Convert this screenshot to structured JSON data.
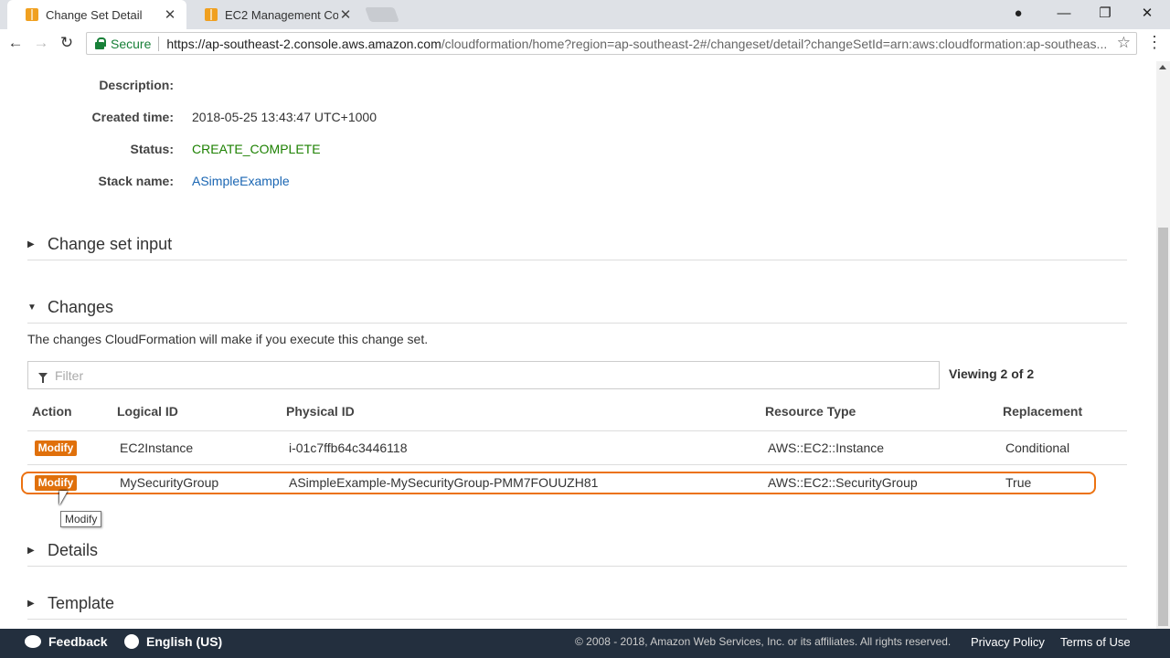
{
  "browser": {
    "tabs": [
      {
        "title": "Change Set Detail",
        "active": true
      },
      {
        "title": "EC2 Management Console",
        "active": false
      }
    ],
    "secure_label": "Secure",
    "url_host": "https://ap-southeast-2.console.aws.amazon.com",
    "url_rest": "/cloudformation/home?region=ap-southeast-2#/changeset/detail?changeSetId=arn:aws:cloudformation:ap-southeas..."
  },
  "details": {
    "description_label": "Description:",
    "description_value": "",
    "created_label": "Created time:",
    "created_value": "2018-05-25 13:43:47 UTC+1000",
    "status_label": "Status:",
    "status_value": "CREATE_COMPLETE",
    "stack_label": "Stack name:",
    "stack_value": "ASimpleExample"
  },
  "sections": {
    "change_set_input": "Change set input",
    "changes": "Changes",
    "details": "Details",
    "template": "Template"
  },
  "changes": {
    "description": "The changes CloudFormation will make if you execute this change set.",
    "filter_placeholder": "Filter",
    "viewing": "Viewing 2 of 2",
    "columns": [
      "Action",
      "Logical ID",
      "Physical ID",
      "Resource Type",
      "Replacement"
    ],
    "rows": [
      {
        "action": "Modify",
        "logical_id": "EC2Instance",
        "physical_id": "i-01c7ffb64c3446118",
        "resource_type": "AWS::EC2::Instance",
        "replacement": "Conditional"
      },
      {
        "action": "Modify",
        "logical_id": "MySecurityGroup",
        "physical_id": "ASimpleExample-MySecurityGroup-PMM7FOUUZH81",
        "resource_type": "AWS::EC2::SecurityGroup",
        "replacement": "True"
      }
    ],
    "tooltip": "Modify"
  },
  "footer": {
    "feedback": "Feedback",
    "language": "English (US)",
    "copyright": "© 2008 - 2018, Amazon Web Services, Inc. or its affiliates. All rights reserved.",
    "privacy": "Privacy Policy",
    "terms": "Terms of Use"
  },
  "colors": {
    "accent_orange": "#e0700b",
    "status_green": "#1d8102",
    "link_blue": "#1a66b3",
    "footer_bg": "#232f3e"
  }
}
